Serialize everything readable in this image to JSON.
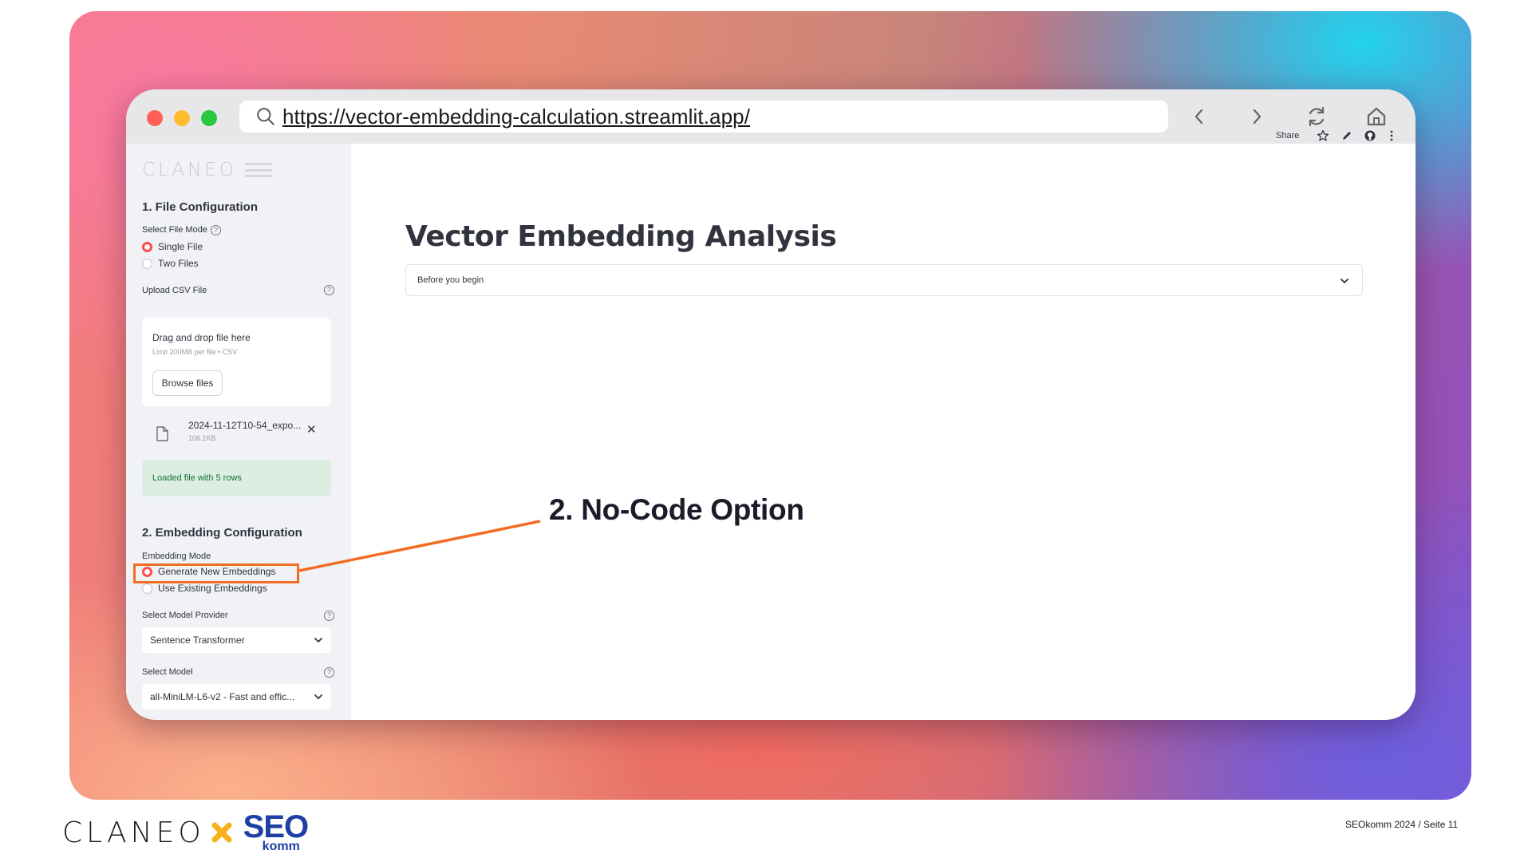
{
  "browser": {
    "url": "https://vector-embedding-calculation.streamlit.app/",
    "icons": [
      "search-icon",
      "back-icon",
      "forward-icon",
      "reload-icon",
      "home-icon"
    ]
  },
  "app": {
    "brand": "CLANEO",
    "toolbar": {
      "share_label": "Share"
    },
    "sidebar": {
      "file_config_heading": "1. File Configuration",
      "file_mode_label": "Select File Mode",
      "file_mode_options": [
        "Single File",
        "Two Files"
      ],
      "file_mode_selected": "Single File",
      "upload_label": "Upload CSV File",
      "drop_text": "Drag and drop file here",
      "drop_limit": "Limit 200MB per file • CSV",
      "browse_label": "Browse files",
      "file_name": "2024-11-12T10-54_expo...",
      "file_size": "106.1KB",
      "success_text": "Loaded file with 5 rows",
      "embedding_heading": "2. Embedding Configuration",
      "embedding_mode_label": "Embedding Mode",
      "embedding_mode_options": [
        "Generate New Embeddings",
        "Use Existing Embeddings"
      ],
      "embedding_mode_selected": "Generate New Embeddings",
      "provider_label": "Select Model Provider",
      "provider_value": "Sentence Transformer",
      "model_label": "Select Model",
      "model_value": "all-MiniLM-L6-v2 - Fast and effic..."
    },
    "main": {
      "title": "Vector Embedding Analysis",
      "expander_label": "Before you begin"
    }
  },
  "annotation": {
    "callout": "2. No-Code Option",
    "color": "#f26d21"
  },
  "footer": {
    "logo_left": "CLANEO",
    "logo_right": "SEO",
    "logo_right_sub": "komm",
    "page_note": "SEOkomm 2024 / Seite 11"
  },
  "colors": {
    "accent_red": "#ff4b4b",
    "success_bg": "#dbeee1",
    "success_text": "#177233",
    "seo_blue": "#1d3fa6",
    "x_yellow": "#f6b21b"
  }
}
